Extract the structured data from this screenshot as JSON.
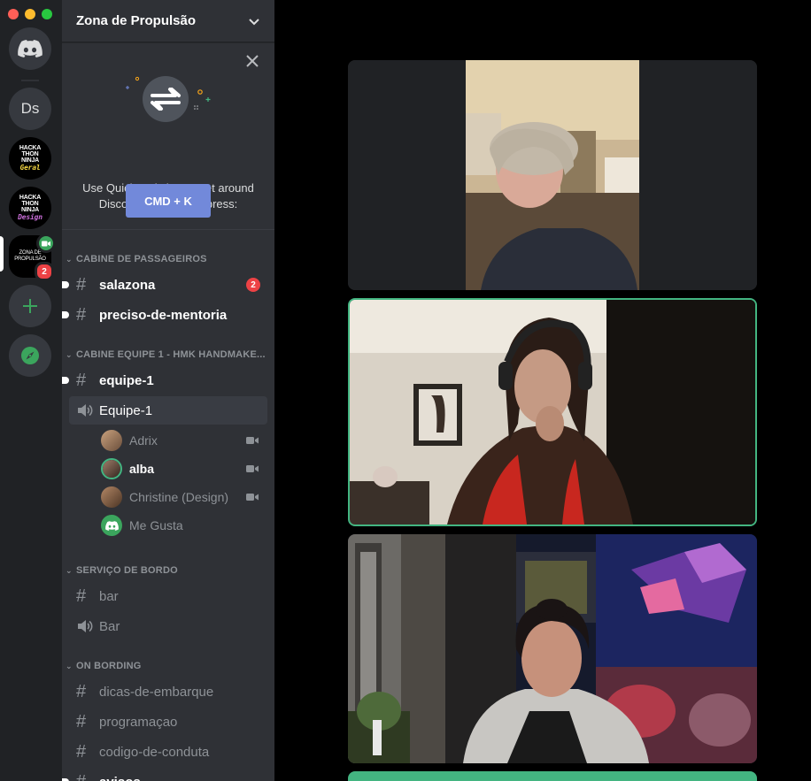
{
  "window": {
    "traffic_colors": [
      "#ff5f57",
      "#febc2e",
      "#28c840"
    ]
  },
  "servers": {
    "home_icon": "discord-logo-icon",
    "ds_label": "Ds",
    "hack_geral": {
      "line1": "HACKA",
      "line2": "THON",
      "line3": "NINJA",
      "tag": "Geral",
      "tag_color": "#f5d742"
    },
    "hack_design": {
      "line1": "HACKA",
      "line2": "THON",
      "line3": "NINJA",
      "tag": "Design",
      "tag_color": "#c86dd7"
    },
    "zona": {
      "line1": "ZONA DE",
      "line2": "PROPULSÃO",
      "badge": "2",
      "video_icon": "video-camera-icon"
    },
    "add_icon": "plus-icon",
    "explore_icon": "compass-icon"
  },
  "guild": {
    "name": "Zona de Propulsão",
    "menu_icon": "chevron-down-icon"
  },
  "quick_switcher": {
    "line1": "Use Quick Switcher to get around",
    "line2": "Discord quickly. Just press:",
    "button": "CMD + K",
    "close_icon": "close-icon"
  },
  "categories": {
    "passageiros": "CABINE DE PASSAGEIROS",
    "equipe": "CABINE EQUIPE 1 - HMK HANDMAKE...",
    "servico": "SERVIÇO DE BORDO",
    "onbording": "ON BORDING"
  },
  "channels": {
    "salazona": {
      "name": "salazona",
      "badge": "2"
    },
    "preciso": {
      "name": "preciso-de-mentoria"
    },
    "equipe_text": {
      "name": "equipe-1"
    },
    "equipe_voice": {
      "name": "Equipe-1"
    },
    "bar_text": {
      "name": "bar"
    },
    "bar_voice": {
      "name": "Bar"
    },
    "dicas": {
      "name": "dicas-de-embarque"
    },
    "programacao": {
      "name": "programaçao"
    },
    "codigo": {
      "name": "codigo-de-conduta"
    },
    "avisos": {
      "name": "avisos"
    }
  },
  "voice_users": [
    {
      "name": "Adrix",
      "video": true
    },
    {
      "name": "alba",
      "video": true
    },
    {
      "name": "Christine (Design)",
      "video": true
    },
    {
      "name": "Me Gusta",
      "video": false
    }
  ],
  "colors": {
    "accent": "#7289da",
    "speaking": "#43b581",
    "badge": "#ed4245"
  }
}
